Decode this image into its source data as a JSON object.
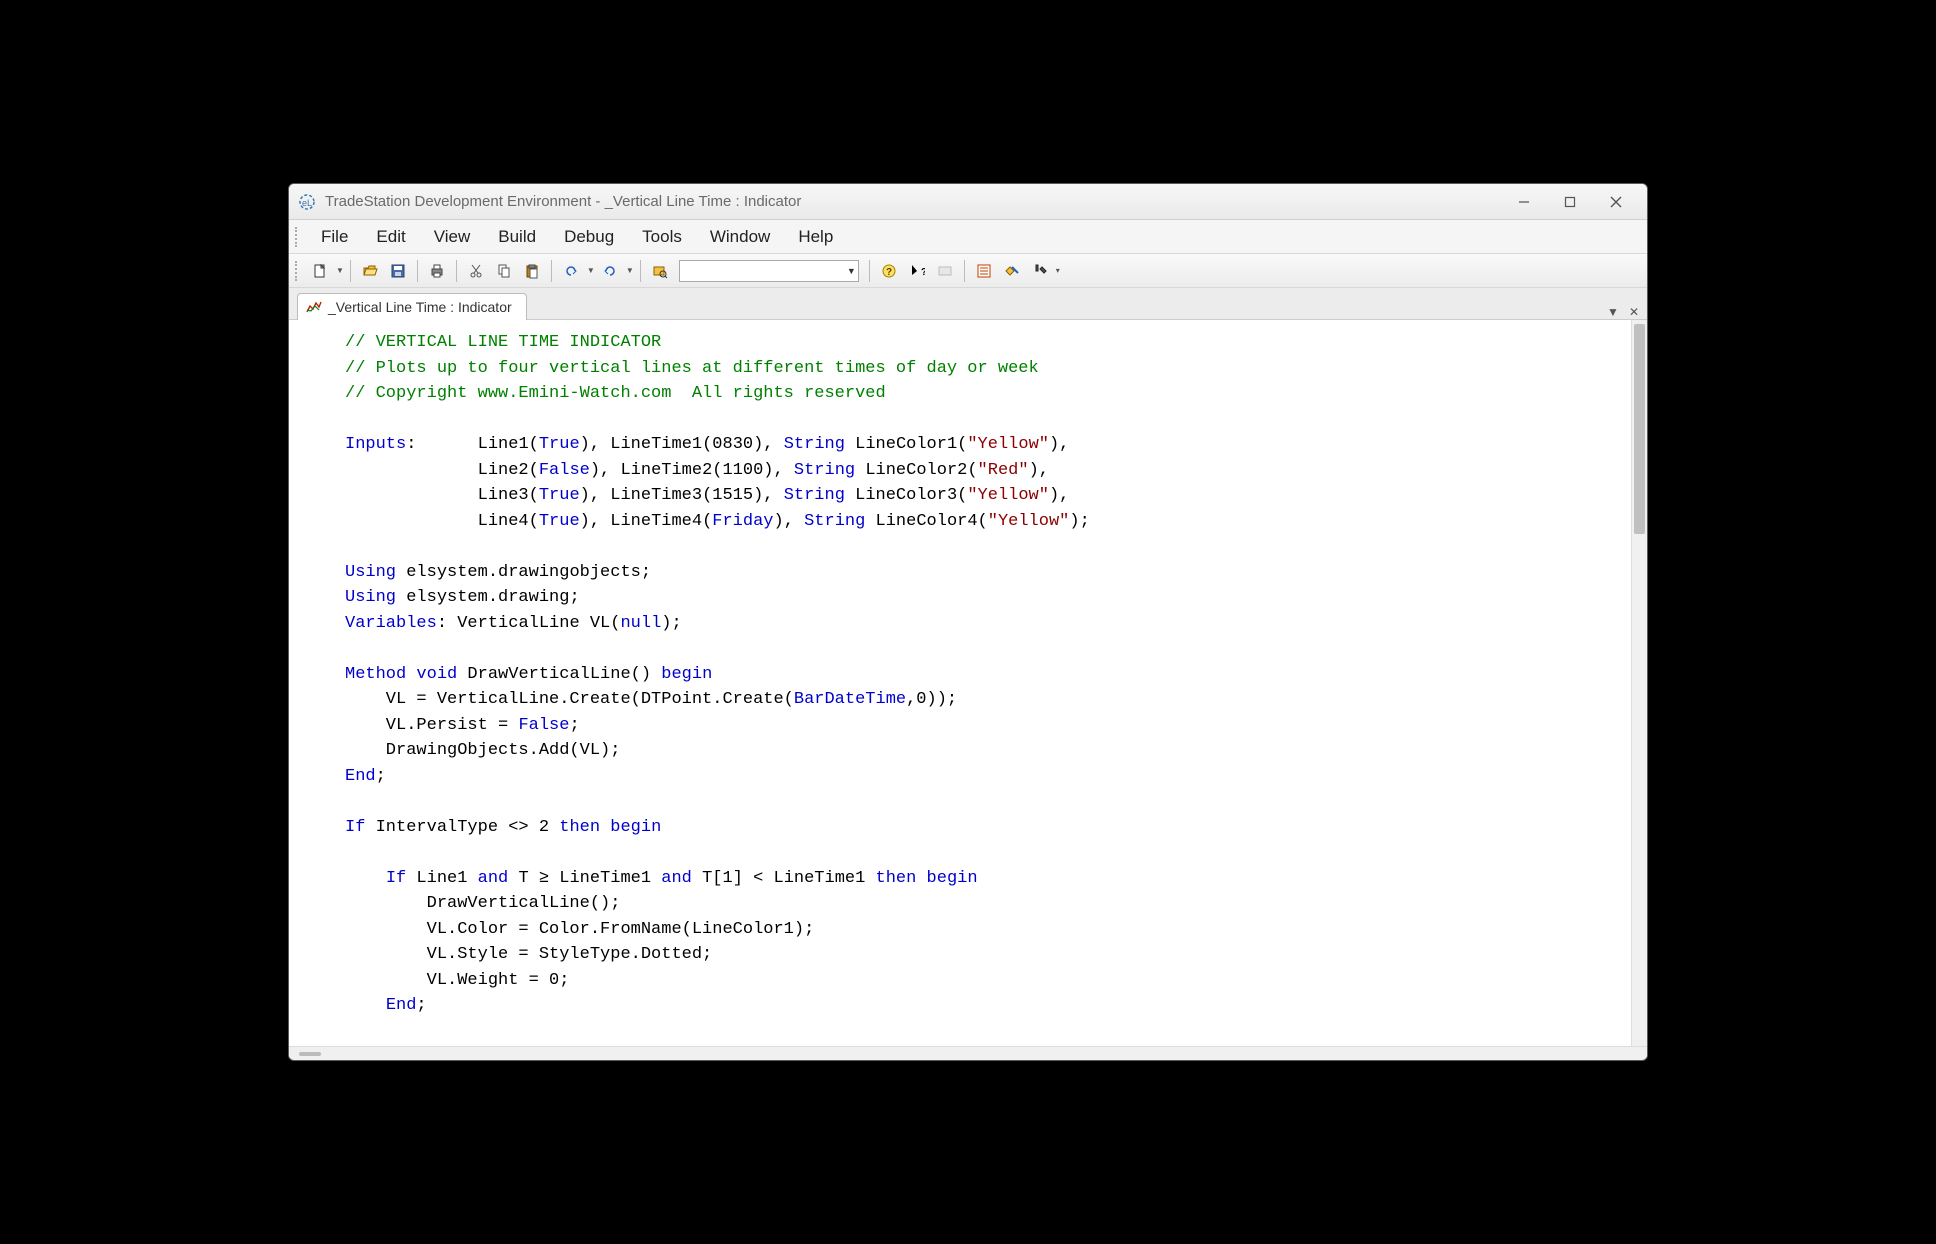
{
  "window": {
    "title": "TradeStation Development Environment - _Vertical Line Time : Indicator"
  },
  "menu": {
    "file": "File",
    "edit": "Edit",
    "view": "View",
    "build": "Build",
    "debug": "Debug",
    "tools": "Tools",
    "window": "Window",
    "help": "Help"
  },
  "tab": {
    "label": "_Vertical Line Time : Indicator"
  },
  "code": {
    "l1": "// VERTICAL LINE TIME INDICATOR",
    "l2": "// Plots up to four vertical lines at different times of day or week",
    "l3": "// Copyright www.Emini-Watch.com  All rights reserved",
    "inputs": "Inputs",
    "line1a": "Line1(",
    "true": "True",
    "false": "False",
    "l1rest": "), LineTime1(0830), ",
    "string": "String",
    "lc1": " LineColor1(",
    "yellow": "\"Yellow\"",
    "red": "\"Red\"",
    "l2a": "Line2(",
    "l2rest": "), LineTime2(1100), ",
    "lc2": " LineColor2(",
    "l3a": "Line3(",
    "l3rest": "), LineTime3(1515), ",
    "lc3": " LineColor3(",
    "l4a": "Line4(",
    "l4rest": "), LineTime4(",
    "friday": "Friday",
    "l4rest2": "), ",
    "lc4": " LineColor4(",
    "using": "Using",
    "u1": " elsystem.drawingobjects;",
    "u2": " elsystem.drawing;",
    "variables": "Variables",
    "vardecl": ": VerticalLine VL(",
    "null": "null",
    "method": "Method",
    "void": "void",
    "dvl": " DrawVerticalLine() ",
    "begin": "begin",
    "m1": "    VL = VerticalLine.Create(DTPoint.Create(",
    "bdt": "BarDateTime",
    "m1b": ",0));",
    "m2": "    VL.Persist = ",
    "m3": "    DrawingObjects.Add(VL);",
    "end": "End",
    "if": "If",
    "itype": " IntervalType <> 2 ",
    "then": "then",
    "if2a": " Line1 ",
    "and": "and",
    "if2b": " T ≥ LineTime1 ",
    "if2c": " T[1] < LineTime1 ",
    "b1": "        DrawVerticalLine();",
    "b2": "        VL.Color = Color.FromName(LineColor1);",
    "b3": "        VL.Style = StyleType.Dotted;",
    "b4": "        VL.Weight = 0;"
  }
}
